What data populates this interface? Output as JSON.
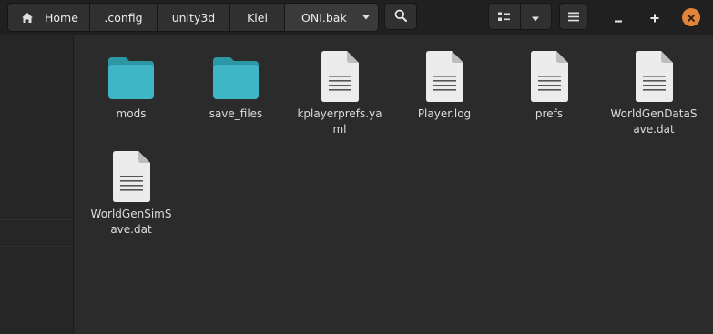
{
  "breadcrumbs": [
    "Home",
    ".config",
    "unity3d",
    "Klei",
    "ONI.bak"
  ],
  "icons": {
    "home": "home-icon",
    "path_dropdown": "chevron-down-icon",
    "search": "search-icon",
    "view_toggle": "grid-view-icon",
    "view_options": "chevron-down-icon",
    "menu": "hamburger-menu-icon",
    "minimize": "minimize-icon",
    "maximize": "maximize-icon",
    "close": "close-icon",
    "folder": "folder-icon",
    "file": "text-file-icon"
  },
  "colors": {
    "folder": "#3fb6c6",
    "folder_tab": "#2e97a6",
    "file": "#ececec",
    "close_button": "#e1853a",
    "background": "#2b2b2b"
  },
  "files": [
    {
      "name": "mods",
      "kind": "folder"
    },
    {
      "name": "save_files",
      "kind": "folder"
    },
    {
      "name": "kplayerprefs.yaml",
      "kind": "file"
    },
    {
      "name": "Player.log",
      "kind": "file"
    },
    {
      "name": "prefs",
      "kind": "file"
    },
    {
      "name": "WorldGenDataSave.dat",
      "kind": "file"
    },
    {
      "name": "WorldGenSimSave.dat",
      "kind": "file"
    }
  ]
}
